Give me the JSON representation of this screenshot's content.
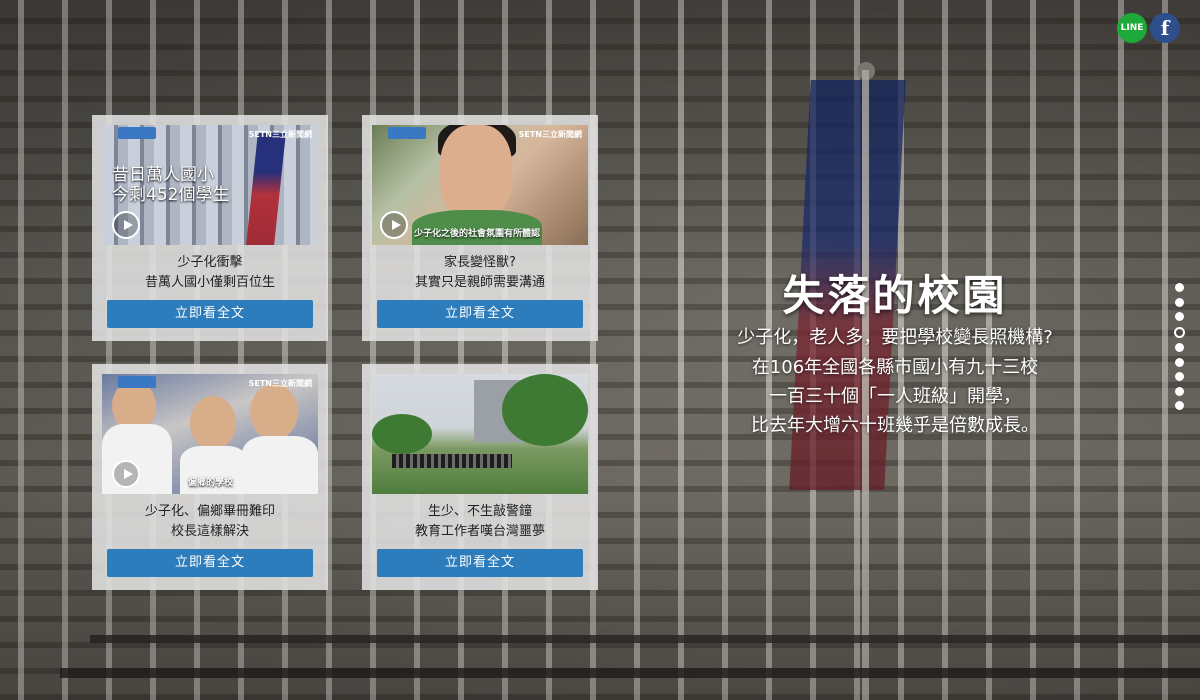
{
  "share": {
    "line_label": "LINE",
    "facebook_label": "f"
  },
  "cards": [
    {
      "thumb_overlay": [
        "昔日萬人國小",
        "今剩452個學生"
      ],
      "thumb_logo": "SETN三立新聞網",
      "caption_line1": "少子化衝擊",
      "caption_line2": "昔萬人國小僅剩百位生",
      "button_label": "立即看全文"
    },
    {
      "thumb_subtitle": "少子化之後的社會氛圍有所體認",
      "thumb_logo": "SETN三立新聞網",
      "caption_line1": "家長變怪獸?",
      "caption_line2": "其實只是親師需要溝通",
      "button_label": "立即看全文"
    },
    {
      "thumb_subtitle": "偏鄉的學校",
      "thumb_logo": "SETN三立新聞網",
      "caption_line1": "少子化、偏鄉畢冊難印",
      "caption_line2": "校長這樣解決",
      "button_label": "立即看全文"
    },
    {
      "caption_line1": "生少、不生敲警鐘",
      "caption_line2": "教育工作者嘆台灣噩夢",
      "button_label": "立即看全文"
    }
  ],
  "hero": {
    "title": "失落的校園",
    "lines": [
      "少子化，老人多，要把學校變長照機構?",
      "在106年全國各縣市國小有九十三校",
      "一百三十個「一人班級」開學，",
      "比去年大增六十班幾乎是倍數成長。"
    ]
  },
  "pager": {
    "total": 9,
    "active_index": 3
  },
  "icons": {
    "play": "play-icon",
    "line": "line-icon",
    "facebook": "facebook-icon"
  }
}
